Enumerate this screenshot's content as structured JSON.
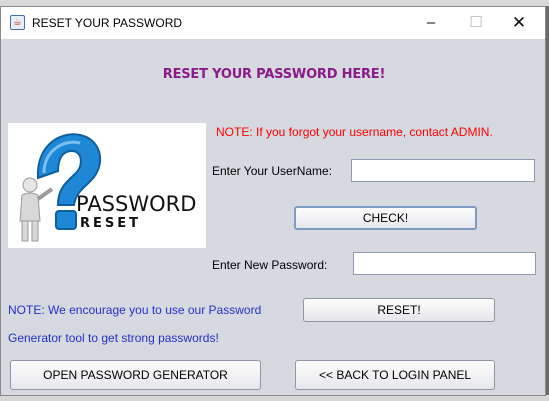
{
  "window": {
    "title": "RESET YOUR PASSWORD"
  },
  "heading": "RESET YOUR PASSWORD HERE!",
  "logo": {
    "line1": "PASSWORD",
    "line2": "RESET"
  },
  "note_username": "NOTE: If you forgot your username, contact ADMIN.",
  "username": {
    "label": "Enter Your UserName:",
    "value": ""
  },
  "check_button": "CHECK!",
  "new_password": {
    "label": "Enter New Password:",
    "value": ""
  },
  "note_generator": {
    "line1": "NOTE: We encourage you to use our Password",
    "line2": "Generator tool to get strong passwords!"
  },
  "reset_button": "RESET!",
  "generator_button": "OPEN PASSWORD GENERATOR",
  "back_button": "<< BACK TO LOGIN PANEL",
  "colors": {
    "heading": "#8b1a8b",
    "note_red": "#ff0000",
    "note_blue": "#2231c9",
    "logo_blue": "#1e88d6"
  }
}
